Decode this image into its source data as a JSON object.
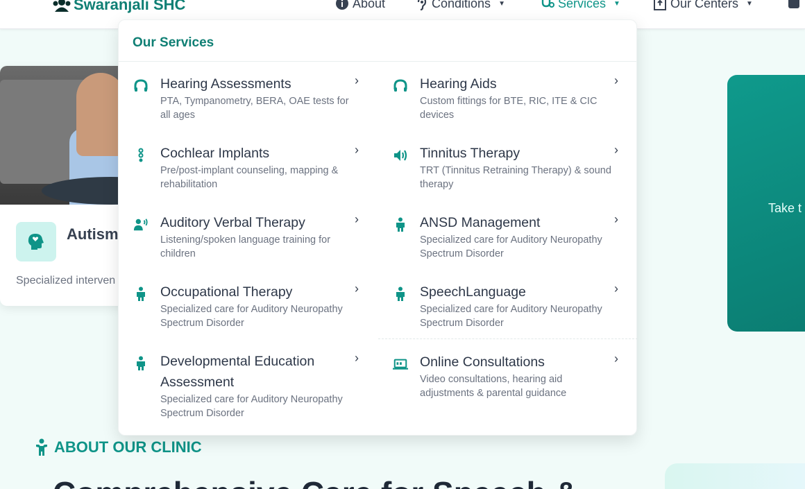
{
  "navbar": {
    "brand": "Swaranjali SHC",
    "items": [
      {
        "label": "About",
        "icon": "info-circle-icon"
      },
      {
        "label": "Conditions",
        "icon": "ear-icon"
      },
      {
        "label": "Services",
        "icon": "stethoscope-icon"
      },
      {
        "label": "Our Centers",
        "icon": "building-icon"
      }
    ]
  },
  "background": {
    "card_title": "Autism",
    "card_desc": "Specialized interven",
    "teal_card_text": "Take t",
    "about_label": "ABOUT OUR CLINIC",
    "headline": "Comprehensive Care for Speech &"
  },
  "dropdown": {
    "header": "Our Services",
    "chevron": "›",
    "left": [
      {
        "title": "Hearing Assessments",
        "desc": "PTA, Tympanometry, BERA, OAE tests for all ages",
        "icon": "headphones-icon"
      },
      {
        "title": "Cochlear Implants",
        "desc": "Pre/post-implant counseling, mapping & rehabilitation",
        "icon": "implant-icon"
      },
      {
        "title": "Auditory Verbal Therapy",
        "desc": "Listening/spoken language training for children",
        "icon": "user-voice-icon"
      },
      {
        "title": "Occupational Therapy",
        "desc": "Specialized care for Auditory Neuropathy Spectrum Disorder",
        "icon": "child-icon"
      },
      {
        "title": "Developmental Education Assessment",
        "desc": "Specialized care for Auditory Neuropathy Spectrum Disorder",
        "icon": "child-icon"
      }
    ],
    "right": [
      {
        "title": "Hearing Aids",
        "desc": "Custom fittings for BTE, RIC, ITE & CIC devices",
        "icon": "headphones-icon"
      },
      {
        "title": "Tinnitus Therapy",
        "desc": "TRT (Tinnitus Retraining Therapy) & sound therapy",
        "icon": "volume-icon"
      },
      {
        "title": "ANSD Management",
        "desc": "Specialized care for Auditory Neuropathy Spectrum Disorder",
        "icon": "child-icon"
      },
      {
        "title": "SpeechLanguage",
        "desc": "Specialized care for Auditory Neuropathy Spectrum Disorder",
        "icon": "child-icon"
      },
      {
        "title": "Online Consultations",
        "desc": "Video consultations, hearing aid adjustments & parental guidance",
        "icon": "laptop-icon"
      }
    ]
  },
  "colors": {
    "accent": "#0f9488",
    "brand": "#0f7f74",
    "page_bg": "#f1fbf9"
  }
}
